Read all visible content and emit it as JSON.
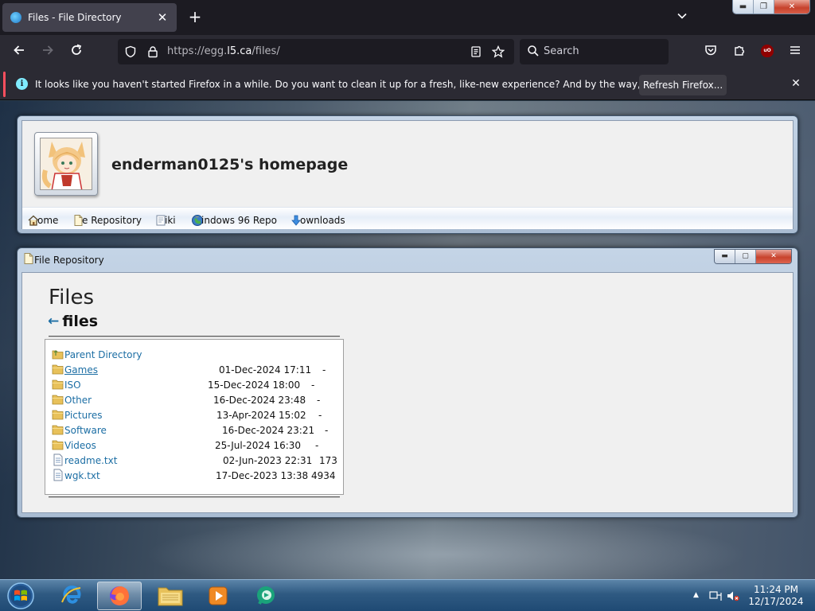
{
  "browser": {
    "tab_title": "Files - File Directory",
    "new_tab_symbol": "+",
    "url_prefix": "https://egg.",
    "url_domain": "l5.ca",
    "url_path": "/files/",
    "search_placeholder": "Search",
    "ublock_label": "uO",
    "notification": {
      "message": "It looks like you haven't started Firefox in a while. Do you want to clean it up for a fresh, like-new experience? And by the way, welcome back!",
      "button": "Refresh Firefox..."
    }
  },
  "site": {
    "title": "enderman0125's homepage",
    "nav": [
      {
        "label": "ome",
        "icon": "home-icon"
      },
      {
        "label": "e Repository",
        "icon": "file-repository-icon"
      },
      {
        "label": "iki",
        "icon": "wiki-icon"
      },
      {
        "label": "indows 96 Repo",
        "icon": "globe-icon"
      },
      {
        "label": "ownloads",
        "icon": "download-arrow-icon"
      }
    ]
  },
  "repo_window": {
    "title": "File Repository",
    "heading": "Files",
    "back_arrow": "←",
    "breadcrumb": "files",
    "parent_directory": "Parent Directory",
    "entries": [
      {
        "name": "Games",
        "date": "01-Dec-2024 17:11",
        "size": "-",
        "type": "folder"
      },
      {
        "name": "ISO",
        "date": "15-Dec-2024 18:00",
        "size": "-",
        "type": "folder"
      },
      {
        "name": "Other",
        "date": "16-Dec-2024 23:48",
        "size": "-",
        "type": "folder"
      },
      {
        "name": "Pictures",
        "date": "13-Apr-2024 15:02",
        "size": "-",
        "type": "folder"
      },
      {
        "name": "Software",
        "date": "16-Dec-2024 23:21",
        "size": "-",
        "type": "folder"
      },
      {
        "name": "Videos",
        "date": "25-Jul-2024 16:30",
        "size": "-",
        "type": "folder"
      },
      {
        "name": "readme.txt",
        "date": "02-Jun-2023 22:31",
        "size": "173",
        "type": "file"
      },
      {
        "name": "wgk.txt",
        "date": "17-Dec-2023 13:38",
        "size": "4934",
        "type": "file"
      }
    ]
  },
  "taskbar": {
    "time": "11:24 PM",
    "date": "12/17/2024"
  },
  "colors": {
    "link": "#1c6ea4",
    "firefox_dark": "#2b2a33",
    "notice_accent": "#ff4f5e"
  }
}
